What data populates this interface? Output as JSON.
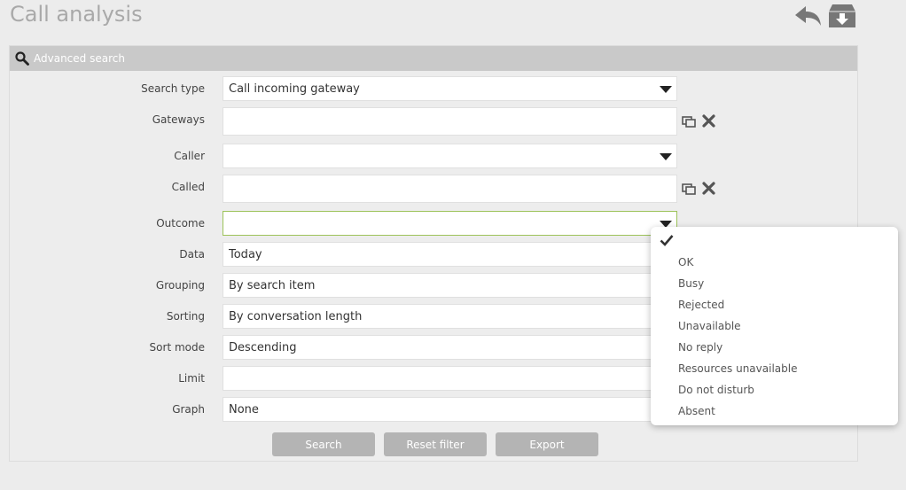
{
  "page": {
    "title": "Call analysis"
  },
  "panel": {
    "header_label": "Advanced search"
  },
  "form": {
    "search_type": {
      "label": "Search type",
      "value": "Call incoming gateway"
    },
    "gateways": {
      "label": "Gateways",
      "value": ""
    },
    "caller": {
      "label": "Caller",
      "value": ""
    },
    "called": {
      "label": "Called",
      "value": ""
    },
    "outcome": {
      "label": "Outcome",
      "value": ""
    },
    "data": {
      "label": "Data",
      "value": "Today"
    },
    "grouping": {
      "label": "Grouping",
      "value": "By search item"
    },
    "sorting": {
      "label": "Sorting",
      "value": "By conversation length"
    },
    "sort_mode": {
      "label": "Sort mode",
      "value": "Descending"
    },
    "limit": {
      "label": "Limit",
      "value": ""
    },
    "graph": {
      "label": "Graph",
      "value": "None"
    }
  },
  "buttons": {
    "search": "Search",
    "reset": "Reset filter",
    "export": "Export"
  },
  "outcome_menu": {
    "items": [
      "OK",
      "Busy",
      "Rejected",
      "Unavailable",
      "No reply",
      "Resources unavailable",
      "Do not disturb",
      "Absent"
    ]
  },
  "icons": {
    "back": "reply-arrow-icon",
    "archive": "download-archive-icon",
    "search": "magnifier-icon",
    "select": "select-window-icon",
    "clear": "clear-x-icon",
    "check": "check-icon"
  },
  "colors": {
    "focus_border": "#9dc35a",
    "button": "#b4b4b4",
    "header": "#c9c9c9"
  }
}
